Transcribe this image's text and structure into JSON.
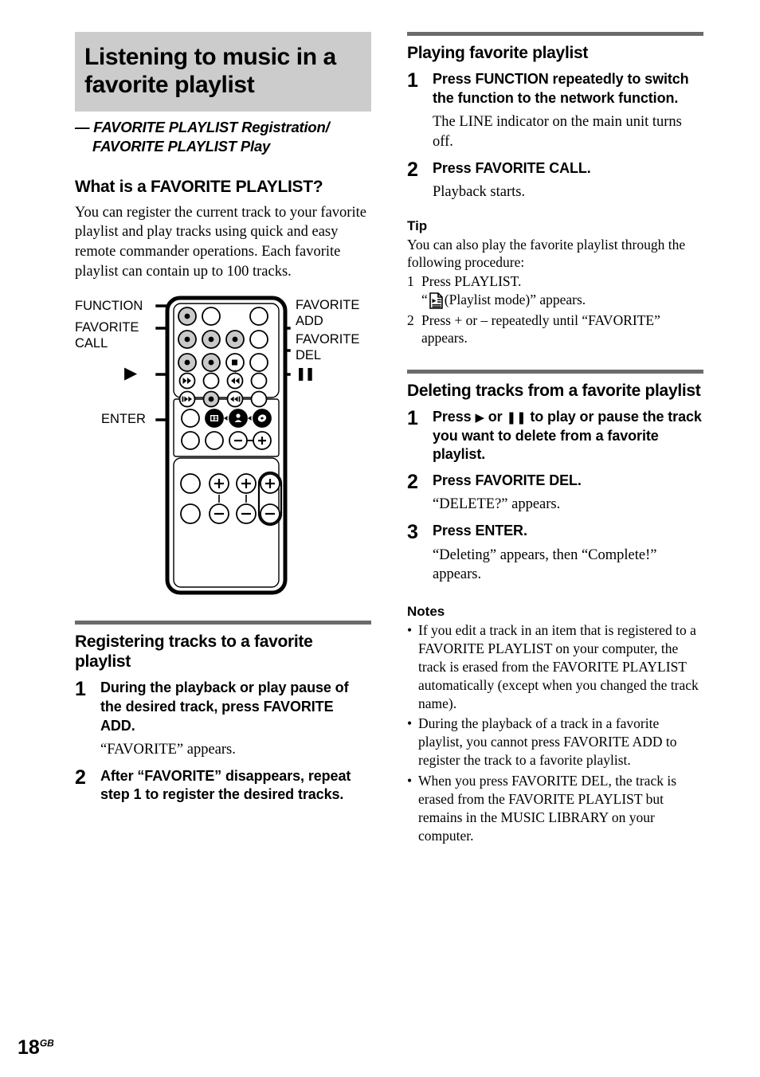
{
  "page": {
    "number": "18",
    "suffix": "GB"
  },
  "left": {
    "title": "Listening to music in a favorite playlist",
    "subtitle": "— FAVORITE PLAYLIST Registration/ FAVORITE PLAYLIST Play",
    "what_is_heading": "What is a FAVORITE PLAYLIST?",
    "what_is_body": "You can register the current track to your favorite playlist and play tracks using quick and easy remote commander operations. Each favorite playlist can contain up to 100 tracks.",
    "remote_labels": {
      "function": "FUNCTION",
      "favorite_call": "FAVORITE\nCALL",
      "play": "▶",
      "enter": "ENTER",
      "favorite_add": "FAVORITE\nADD",
      "favorite_del": "FAVORITE\nDEL",
      "pause": "❚❚"
    },
    "registering": {
      "heading": "Registering tracks to a favorite playlist",
      "steps": [
        {
          "num": "1",
          "title": "During the playback or play pause of the desired track, press FAVORITE ADD.",
          "result": "“FAVORITE” appears."
        },
        {
          "num": "2",
          "title": "After “FAVORITE” disappears, repeat step 1 to register the desired tracks.",
          "result": ""
        }
      ]
    }
  },
  "right": {
    "playing": {
      "heading": "Playing favorite playlist",
      "steps": [
        {
          "num": "1",
          "title": "Press FUNCTION repeatedly to switch the function to the network function.",
          "result": "The LINE indicator on the main unit turns off."
        },
        {
          "num": "2",
          "title": "Press FAVORITE CALL.",
          "result": "Playback starts."
        }
      ]
    },
    "tip": {
      "heading": "Tip",
      "intro": "You can also play the favorite playlist through the following procedure:",
      "items": [
        {
          "num": "1",
          "text": "Press PLAYLIST."
        },
        {
          "num": "2",
          "text": "Press + or – repeatedly until “FAVORITE” appears."
        }
      ],
      "icon_line_prefix": "“",
      "icon_name": "playlist-mode-icon",
      "icon_line_suffix": " (Playlist mode)” appears."
    },
    "deleting": {
      "heading": "Deleting tracks from a favorite playlist",
      "steps": [
        {
          "num": "1",
          "title_pre": "Press ",
          "title_play": "▶",
          "title_mid": " or ",
          "title_pause": "❚❚",
          "title_post": " to play or pause the track you want to delete from a favorite playlist.",
          "result": ""
        },
        {
          "num": "2",
          "title": "Press FAVORITE DEL.",
          "result": "“DELETE?” appears."
        },
        {
          "num": "3",
          "title": "Press ENTER.",
          "result": "“Deleting” appears, then “Complete!” appears."
        }
      ]
    },
    "notes": {
      "heading": "Notes",
      "bullet": "•",
      "items": [
        "If you edit a track in an item that is registered to a FAVORITE PLAYLIST on your computer, the track is erased from the FAVORITE PLAYLIST automatically (except when you changed the track name).",
        "During the playback of a track in a favorite playlist, you cannot press FAVORITE ADD to register the track to a favorite playlist.",
        "When you press FAVORITE DEL, the track is erased from the FAVORITE PLAYLIST but remains in the MUSIC LIBRARY on your computer."
      ]
    }
  },
  "colors": {
    "banner_gray": "#cccccc",
    "rule_gray": "#6b6b6b",
    "button_highlight": "#c9c9c9"
  }
}
